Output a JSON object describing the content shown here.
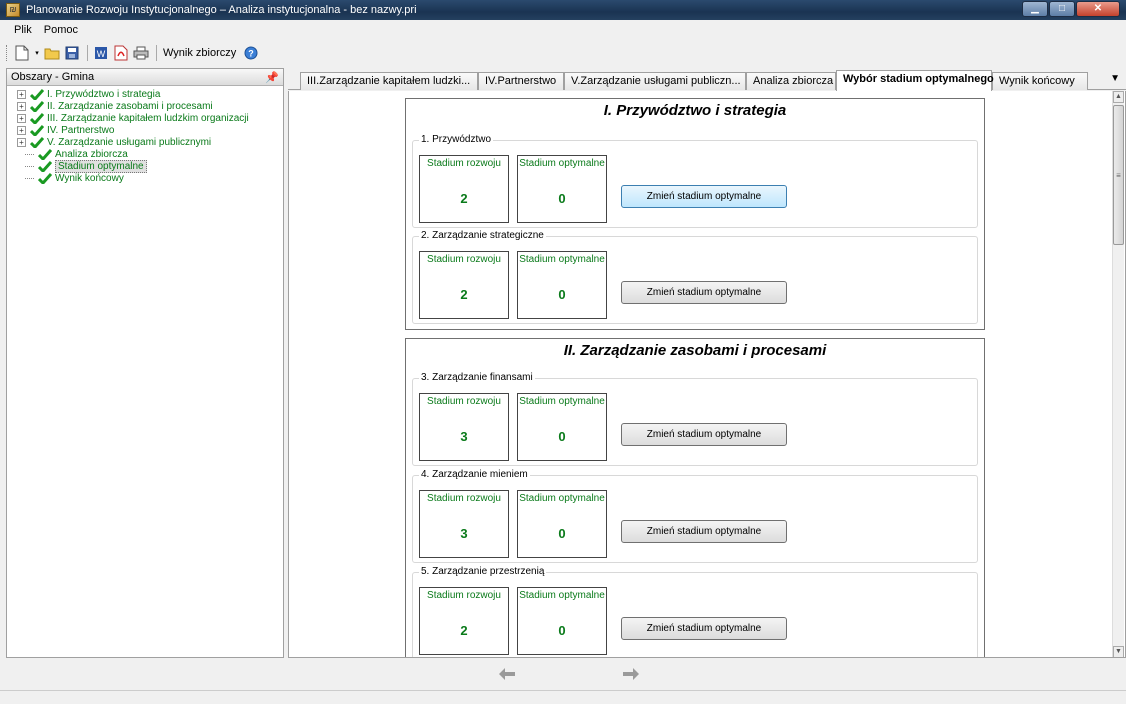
{
  "window": {
    "title": "Planowanie Rozwoju Instytucjonalnego – Analiza instytucjonalna - bez nazwy.pri"
  },
  "menu": [
    "Plik",
    "Pomoc"
  ],
  "toolbar": {
    "summary_label": "Wynik zbiorczy"
  },
  "left_panel": {
    "title": "Obszary - Gmina",
    "items": [
      {
        "label": "I. Przywództwo i strategia",
        "expandable": true
      },
      {
        "label": "II. Zarządzanie zasobami i procesami",
        "expandable": true
      },
      {
        "label": "III. Zarządzanie kapitałem ludzkim organizacji",
        "expandable": true
      },
      {
        "label": "IV. Partnerstwo",
        "expandable": true
      },
      {
        "label": "V. Zarządzanie usługami publicznymi",
        "expandable": true
      },
      {
        "label": "Analiza zbiorcza",
        "expandable": false
      },
      {
        "label": "Stadium optymalne",
        "expandable": false,
        "selected": true
      },
      {
        "label": "Wynik końcowy",
        "expandable": false
      }
    ]
  },
  "tabs": [
    {
      "label": "III.Zarządzanie kapitałem ludzki..."
    },
    {
      "label": "IV.Partnerstwo"
    },
    {
      "label": "V.Zarządzanie usługami publiczn..."
    },
    {
      "label": "Analiza zbiorcza"
    },
    {
      "label": "Wybór stadium optymalnego",
      "active": true
    },
    {
      "label": "Wynik końcowy"
    }
  ],
  "labels": {
    "stage_dev": "Stadium rozwoju",
    "stage_opt": "Stadium optymalne",
    "change_button": "Zmień stadium optymalne"
  },
  "sections": [
    {
      "title": "I. Przywództwo i strategia",
      "groups": [
        {
          "label": "1. Przywództwo",
          "dev": "2",
          "opt": "0"
        },
        {
          "label": "2. Zarządzanie strategiczne",
          "dev": "2",
          "opt": "0"
        }
      ]
    },
    {
      "title": "II. Zarządzanie zasobami i procesami",
      "groups": [
        {
          "label": "3. Zarządzanie finansami",
          "dev": "3",
          "opt": "0"
        },
        {
          "label": "4. Zarządzanie mieniem",
          "dev": "3",
          "opt": "0"
        },
        {
          "label": "5. Zarządzanie przestrzenią",
          "dev": "2",
          "opt": "0"
        }
      ]
    }
  ],
  "colors": {
    "accent_green": "#0a7a1a",
    "titlebar": "#1a3352"
  }
}
